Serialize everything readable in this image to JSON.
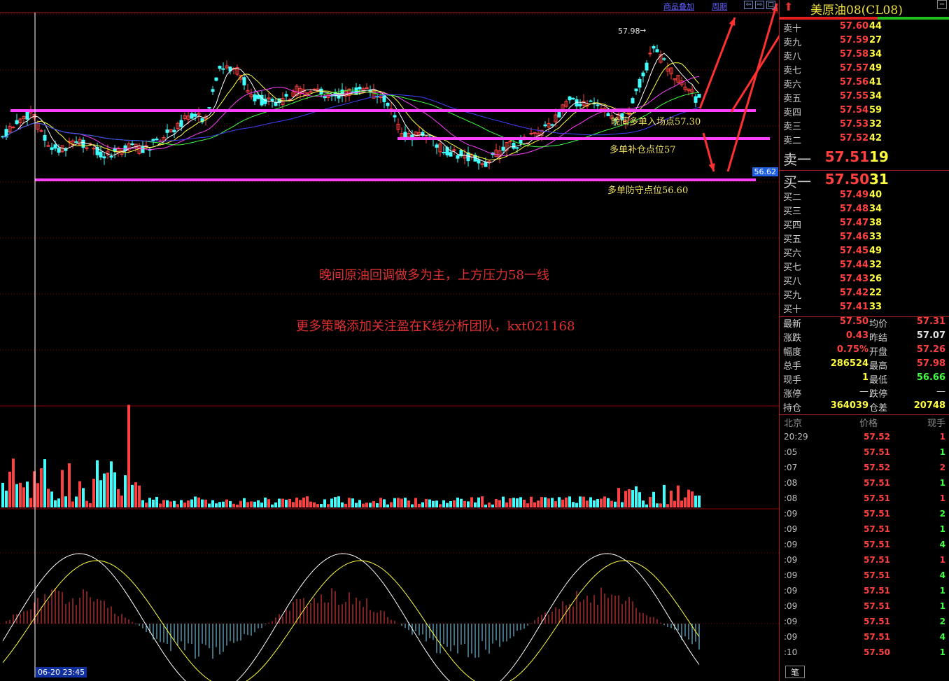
{
  "toolbar": {
    "overlay_label": "商品叠加",
    "period_label": "周期"
  },
  "symbol": {
    "title": "美原油08(CL08)"
  },
  "chart": {
    "high_marker": "57.98",
    "current_price_tag": "56.62",
    "date_cursor": "06-20 23:45",
    "annotations": {
      "entry": "晚间多单入场点57.30",
      "add": "多单补仓点位57",
      "stop": "多单防守点位56.60",
      "headline": "晚间原油回调做多为主，上方压力58一线",
      "promo": "更多策略添加关注盈在K线分析团队，kxt021168"
    }
  },
  "orderbook": {
    "asks": [
      {
        "label": "卖十",
        "price": "57.60",
        "vol": "44"
      },
      {
        "label": "卖九",
        "price": "57.59",
        "vol": "27"
      },
      {
        "label": "卖八",
        "price": "57.58",
        "vol": "34"
      },
      {
        "label": "卖七",
        "price": "57.57",
        "vol": "49"
      },
      {
        "label": "卖六",
        "price": "57.56",
        "vol": "41"
      },
      {
        "label": "卖五",
        "price": "57.55",
        "vol": "34"
      },
      {
        "label": "卖四",
        "price": "57.54",
        "vol": "59"
      },
      {
        "label": "卖三",
        "price": "57.53",
        "vol": "32"
      },
      {
        "label": "卖二",
        "price": "57.52",
        "vol": "42"
      },
      {
        "label": "卖一",
        "price": "57.51",
        "vol": "19"
      }
    ],
    "bids": [
      {
        "label": "买一",
        "price": "57.50",
        "vol": "31"
      },
      {
        "label": "买二",
        "price": "57.49",
        "vol": "40"
      },
      {
        "label": "买三",
        "price": "57.48",
        "vol": "34"
      },
      {
        "label": "买四",
        "price": "57.47",
        "vol": "38"
      },
      {
        "label": "买五",
        "price": "57.46",
        "vol": "33"
      },
      {
        "label": "买六",
        "price": "57.45",
        "vol": "49"
      },
      {
        "label": "买七",
        "price": "57.44",
        "vol": "32"
      },
      {
        "label": "买八",
        "price": "57.43",
        "vol": "26"
      },
      {
        "label": "买九",
        "price": "57.42",
        "vol": "22"
      },
      {
        "label": "买十",
        "price": "57.41",
        "vol": "33"
      }
    ]
  },
  "stats": {
    "latest_l": "最新",
    "latest": "57.50",
    "avg_l": "均价",
    "avg": "57.31",
    "change_l": "涨跌",
    "change": "0.43",
    "prevclose_l": "昨结",
    "prevclose": "57.07",
    "range_l": "幅度",
    "range": "0.75%",
    "open_l": "开盘",
    "open": "57.26",
    "volume_l": "总手",
    "volume": "286524",
    "high_l": "最高",
    "high": "57.98",
    "cur_l": "现手",
    "cur": "1",
    "low_l": "最低",
    "low": "56.66",
    "limitup_l": "涨停",
    "limitup": "—",
    "limitdown_l": "跌停",
    "limitdown": "—",
    "oi_l": "持仓",
    "oi": "364039",
    "oidiff_l": "仓差",
    "oidiff": "20748"
  },
  "ticks": {
    "hdr_city": "北京",
    "hdr_price": "价格",
    "hdr_vol": "现手",
    "rows": [
      {
        "t": "20:29",
        "p": "57.52",
        "v": "1",
        "c": "#ff4040"
      },
      {
        "t": ":05",
        "p": "57.51",
        "v": "1",
        "c": "#40ff40"
      },
      {
        "t": ":07",
        "p": "57.52",
        "v": "2",
        "c": "#ff4040"
      },
      {
        "t": ":08",
        "p": "57.51",
        "v": "1",
        "c": "#40ff40"
      },
      {
        "t": ":08",
        "p": "57.51",
        "v": "1",
        "c": "#ff4040"
      },
      {
        "t": ":09",
        "p": "57.51",
        "v": "2",
        "c": "#40ff40"
      },
      {
        "t": ":09",
        "p": "57.51",
        "v": "1",
        "c": "#40ff40"
      },
      {
        "t": ":09",
        "p": "57.51",
        "v": "4",
        "c": "#40ff40"
      },
      {
        "t": ":09",
        "p": "57.51",
        "v": "1",
        "c": "#ff4040"
      },
      {
        "t": ":09",
        "p": "57.51",
        "v": "4",
        "c": "#40ff40"
      },
      {
        "t": ":09",
        "p": "57.51",
        "v": "1",
        "c": "#40ff40"
      },
      {
        "t": ":09",
        "p": "57.51",
        "v": "1",
        "c": "#40ff40"
      },
      {
        "t": ":09",
        "p": "57.51",
        "v": "2",
        "c": "#40ff40"
      },
      {
        "t": ":09",
        "p": "57.51",
        "v": "4",
        "c": "#40ff40"
      },
      {
        "t": ":10",
        "p": "57.50",
        "v": "1",
        "c": "#40ff40"
      }
    ],
    "tab_label": "笔"
  },
  "colors": {
    "up": "#ff4040",
    "down": "#40ffff",
    "magenta": "#ff40ff",
    "grid": "#8b0000"
  }
}
